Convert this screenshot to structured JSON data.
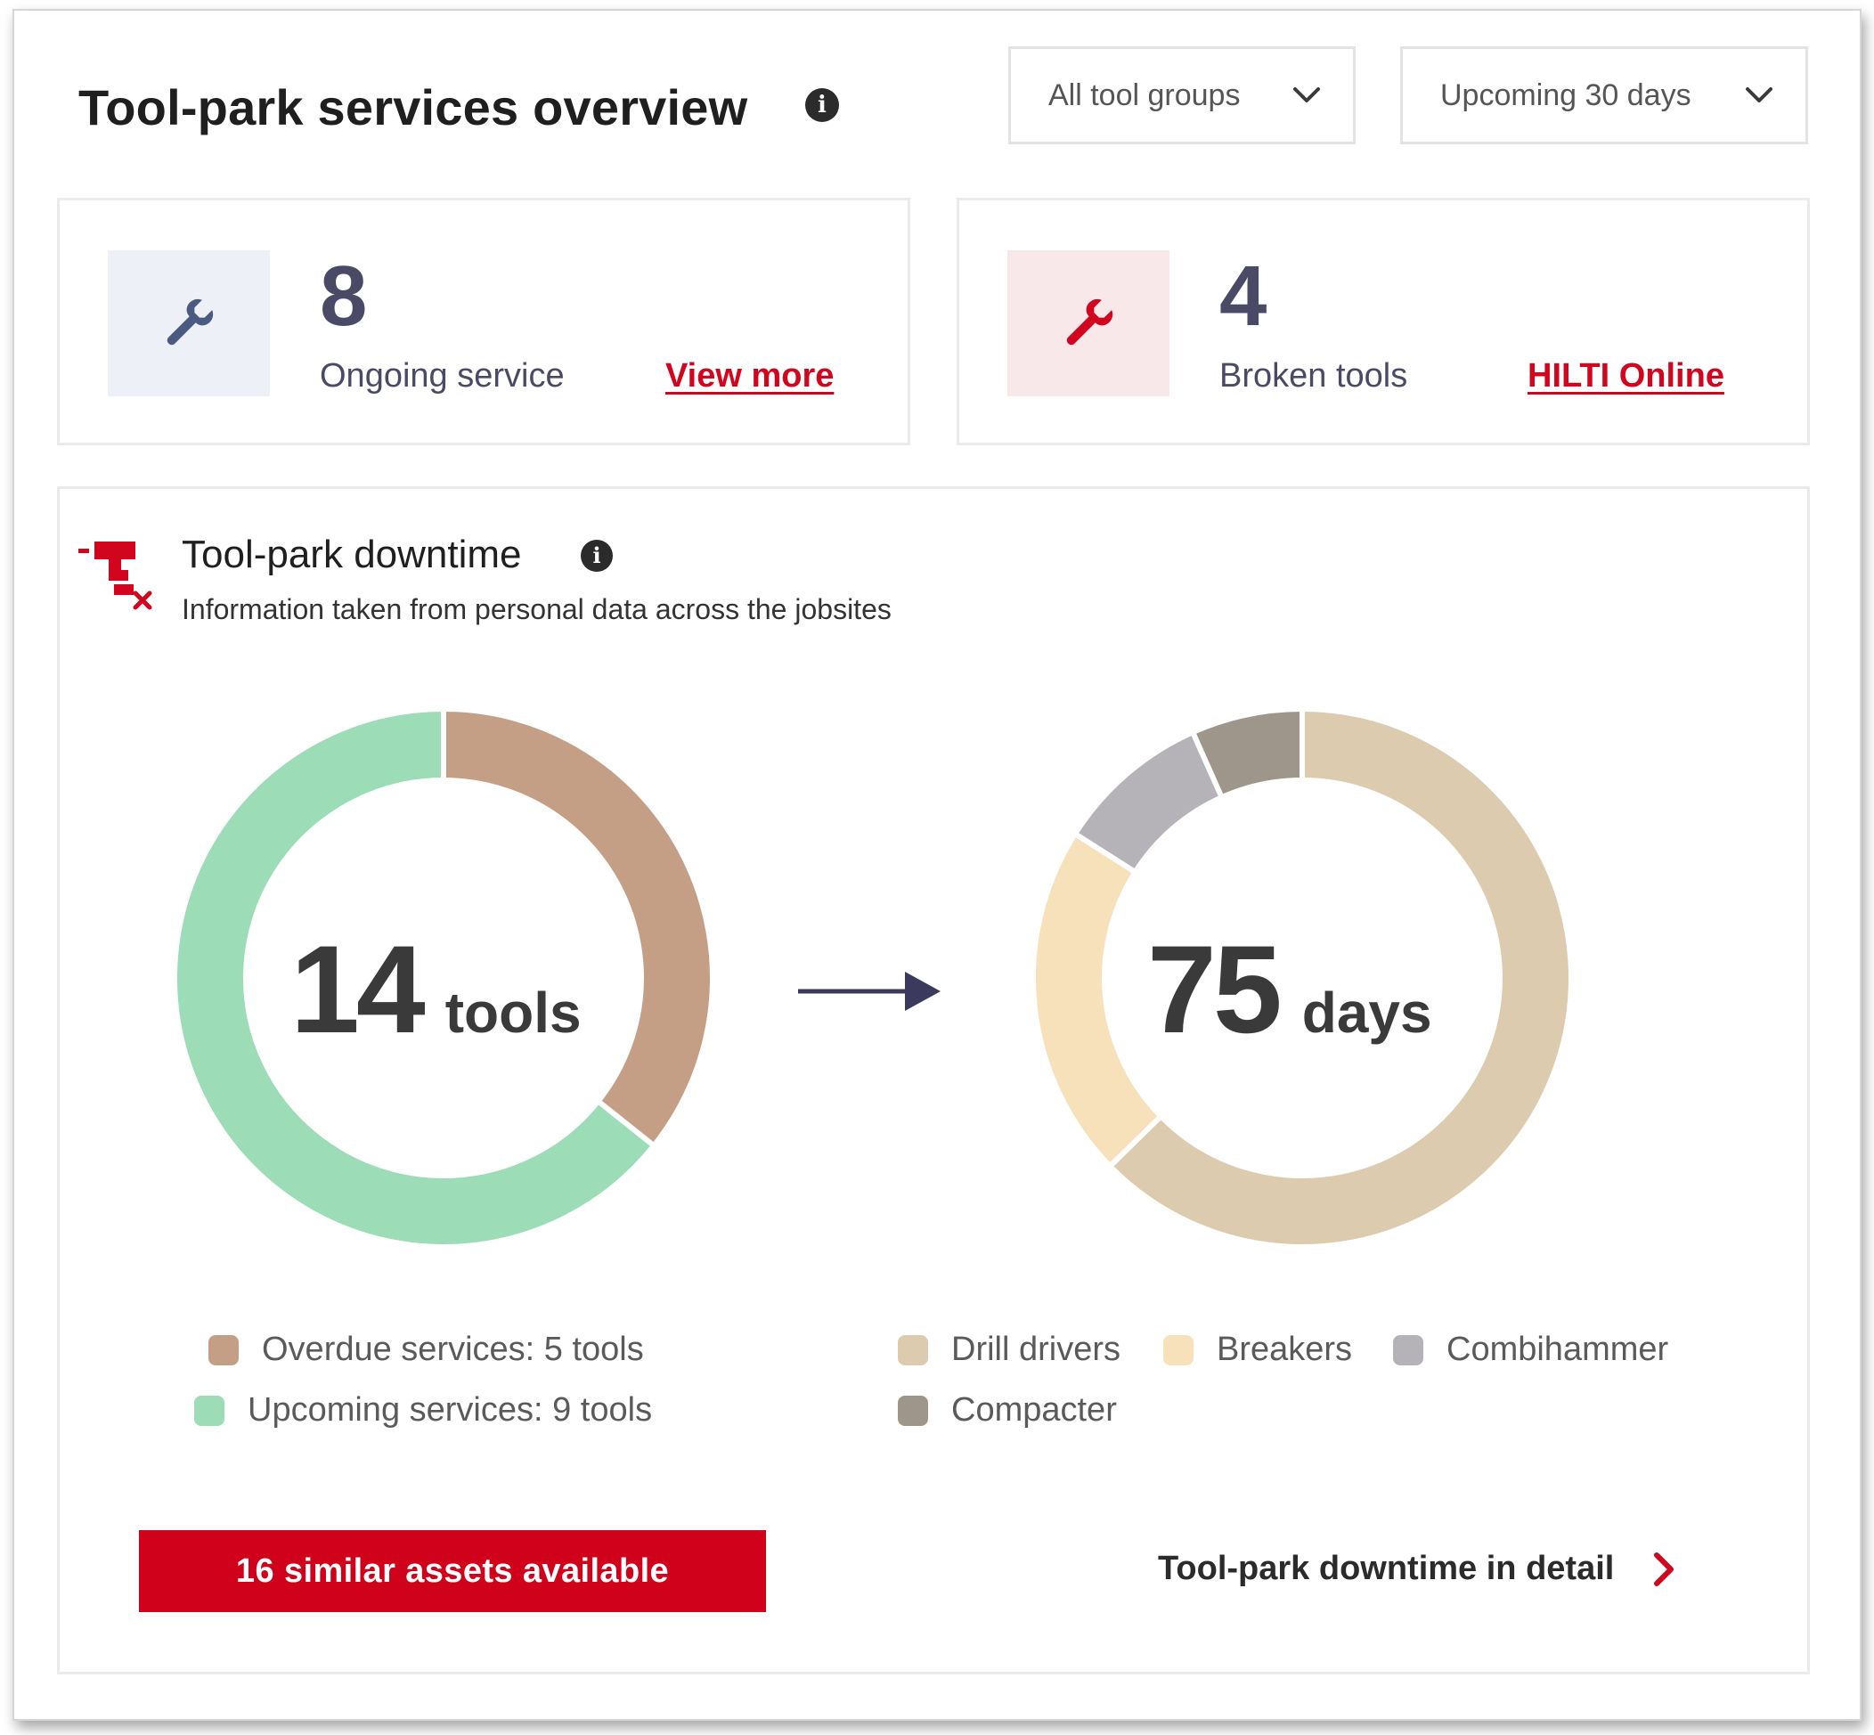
{
  "header": {
    "title": "Tool-park services overview",
    "info_icon": "i",
    "filters": [
      {
        "label": "All tool groups",
        "icon": "chevron-down-icon"
      },
      {
        "label": "Upcoming 30 days",
        "icon": "chevron-down-icon"
      }
    ]
  },
  "kpis": [
    {
      "value": "8",
      "label": "Ongoing service",
      "link": "View more",
      "icon": "wrench-icon",
      "accent": "#4a5a80",
      "bg": "#edf1f7"
    },
    {
      "value": "4",
      "label": "Broken tools",
      "link": "HILTI Online",
      "icon": "wrench-icon",
      "accent": "#d2051e",
      "bg": "#f8e8ea"
    }
  ],
  "downtime": {
    "title": "Tool-park downtime",
    "subtitle": "Information taken from personal data across the jobsites",
    "icon": "broken-drill-icon",
    "info_icon": "i",
    "button_label": "16 similar assets available",
    "detail_link": "Tool-park downtime in detail",
    "detail_icon": "chevron-right-icon"
  },
  "chart_data": [
    {
      "type": "pie",
      "donut": true,
      "center_value": "14",
      "center_unit": "tools",
      "categories": [
        "Overdue services: 5 tools",
        "Upcoming services: 9 tools"
      ],
      "values": [
        5,
        9
      ],
      "colors": [
        "#c49f86",
        "#9cdcb7"
      ]
    },
    {
      "type": "pie",
      "donut": true,
      "center_value": "75",
      "center_unit": "days",
      "categories": [
        "Drill drivers",
        "Breakers",
        "Combihammer",
        "Compacter"
      ],
      "values": [
        47,
        16,
        7,
        5
      ],
      "colors": [
        "#dccbaf",
        "#f6e1ba",
        "#b5b3b8",
        "#9e968a"
      ]
    }
  ],
  "colors": {
    "brand_red": "#d2051e",
    "kpi_number": "#4a4a66",
    "arrow": "#3c3a5c"
  }
}
